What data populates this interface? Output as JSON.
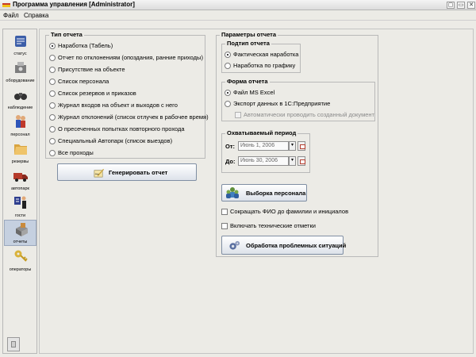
{
  "window": {
    "title": "Программа управления [Administrator]",
    "controls": [
      "▢",
      "▭",
      "✕"
    ]
  },
  "menu": [
    "Файл",
    "Справка"
  ],
  "sidebar": [
    {
      "label": "статус",
      "icon": "status-icon"
    },
    {
      "label": "оборудование",
      "icon": "equipment-icon"
    },
    {
      "label": "наблюдение",
      "icon": "binoculars-icon"
    },
    {
      "label": "персонал",
      "icon": "personnel-icon"
    },
    {
      "label": "резервы",
      "icon": "folder-icon"
    },
    {
      "label": "автопарк",
      "icon": "truck-icon"
    },
    {
      "label": "гости",
      "icon": "guests-icon"
    },
    {
      "label": "отчеты",
      "icon": "reports-icon"
    },
    {
      "label": "операторы",
      "icon": "key-icon"
    }
  ],
  "report_type": {
    "title": "Тип отчета",
    "selected_index": 0,
    "options": [
      "Наработка (Табель)",
      "Отчет по отклонениям (опоздания, ранние приходы)",
      "Присутствие на объекте",
      "Список персонала",
      "Список резервов и приказов",
      "Журнал входов на объект и выходов с него",
      "Журнал отклонений (список отлучек в рабочее время)",
      "О пресеченных попытках повторного прохода",
      "Специальный Автопарк (список выездов)",
      "Все проходы"
    ]
  },
  "generate_button": "Генерировать отчет",
  "params": {
    "title": "Параметры отчета",
    "subtype": {
      "title": "Подтип отчета",
      "selected_index": 0,
      "options": [
        "Фактическая наработка",
        "Наработка по графику"
      ]
    },
    "form": {
      "title": "Форма отчета",
      "selected_index": 0,
      "options": [
        "Файл MS Excel",
        "Экспорт данных в 1С:Предприятие"
      ],
      "auto_checkbox": "Автоматически проводить созданный документ"
    },
    "period": {
      "title": "Охватываемый период",
      "from_label": "От:",
      "from_value": "Июнь 1, 2006",
      "to_label": "До:",
      "to_value": "Июнь 30, 2006"
    },
    "select_personnel_button": "Выборка персонала",
    "shorten_checkbox": "Сокращать ФИО до фамилии и инициалов",
    "tech_checkbox": "Включать технические отметки",
    "problems_button": "Обработка проблемных ситуаций"
  }
}
